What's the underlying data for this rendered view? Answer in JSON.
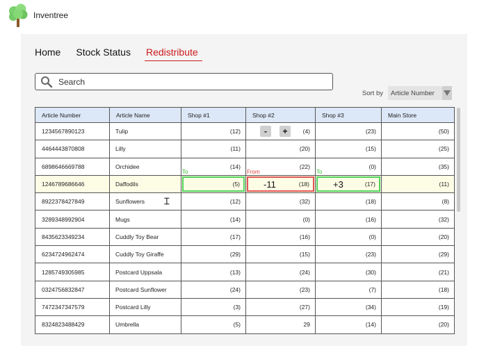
{
  "app": {
    "name": "Inventree",
    "logo_icon": "tree-icon"
  },
  "nav": {
    "tabs": [
      {
        "label": "Home",
        "active": false
      },
      {
        "label": "Stock Status",
        "active": false
      },
      {
        "label": "Redistribute",
        "active": true
      }
    ]
  },
  "search": {
    "placeholder": "Search",
    "value": ""
  },
  "sort": {
    "label": "Sort by",
    "value": "Article Number"
  },
  "table": {
    "columns": [
      "Article Number",
      "Article Name",
      "Shop #1",
      "Shop #2",
      "Shop #3",
      "Main Store"
    ],
    "rows": [
      {
        "article": "1234567890123",
        "name": "Tulip",
        "shop1": "(12)",
        "shop2": "(4)",
        "shop3": "(23)",
        "main": "(50)"
      },
      {
        "article": "4464443870808",
        "name": "Lilly",
        "shop1": "(11)",
        "shop2": "(20)",
        "shop3": "(15)",
        "main": "(25)"
      },
      {
        "article": "6898646669788",
        "name": "Orchidee",
        "shop1": "(14)",
        "shop2": "(22)",
        "shop3": "(0)",
        "main": "(35)"
      },
      {
        "article": "1246789686646",
        "name": "Daffodils",
        "shop1": "(5)",
        "shop2": "(18)",
        "shop3": "(17)",
        "main": "(11)"
      },
      {
        "article": "8922378427849",
        "name": "Sunflowers",
        "shop1": "(12)",
        "shop2": "(32)",
        "shop3": "(18)",
        "main": "(8)"
      },
      {
        "article": "3289348992904",
        "name": "Mugs",
        "shop1": "(14)",
        "shop2": "(0)",
        "shop3": "(16)",
        "main": "(32)"
      },
      {
        "article": "8435623349234",
        "name": "Cuddly Toy Bear",
        "shop1": "(17)",
        "shop2": "(16)",
        "shop3": "(0)",
        "main": "(20)"
      },
      {
        "article": "6234724962474",
        "name": "Cuddly Toy Giraffe",
        "shop1": "(29)",
        "shop2": "(15)",
        "shop3": "(23)",
        "main": "(29)"
      },
      {
        "article": "1285749305985",
        "name": "Postcard Uppsala",
        "shop1": "(13)",
        "shop2": "(24)",
        "shop3": "(30)",
        "main": "(21)"
      },
      {
        "article": "0324756832847",
        "name": "Postcard Sunflower",
        "shop1": "(24)",
        "shop2": "(23)",
        "shop3": "(7)",
        "main": "(18)"
      },
      {
        "article": "7472347347579",
        "name": "Postcard Lilly",
        "shop1": "(3)",
        "shop2": "(27)",
        "shop3": "(34)",
        "main": "(19)"
      },
      {
        "article": "8324823488429",
        "name": "Umbrella",
        "shop1": "(5)",
        "shop2": "29",
        "shop3": "(14)",
        "main": "(20)"
      }
    ]
  },
  "redistribute": {
    "to_label": "To",
    "from_label": "From",
    "from_delta": "-11",
    "to_delta": "+3",
    "stepper_minus": "-",
    "stepper_plus": "+"
  },
  "colors": {
    "accent": "#cc1a1a",
    "header_bg": "#dce8f7",
    "to_green": "#4fd45a",
    "from_red": "#e05555",
    "highlight_row": "#fdfde6"
  }
}
